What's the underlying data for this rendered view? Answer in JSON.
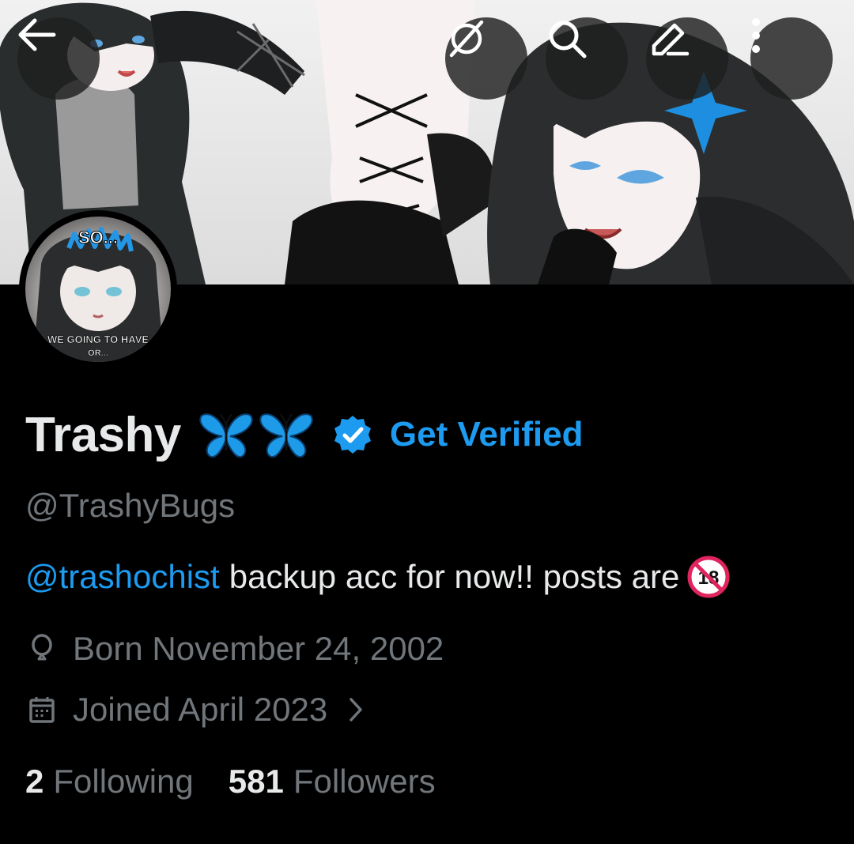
{
  "profile": {
    "display_name": "Trashy",
    "name_emoji": [
      "butterfly",
      "butterfly"
    ],
    "get_verified_label": "Get Verified",
    "handle": "@TrashyBugs",
    "bio": {
      "mention": "@trashochist",
      "text": "backup acc for now!! posts are",
      "emoji": "no-one-under-eighteen"
    },
    "born": "Born November 24, 2002",
    "joined": "Joined April 2023"
  },
  "stats": {
    "following_count": "2",
    "following_label": "Following",
    "followers_count": "581",
    "followers_label": "Followers"
  },
  "avatar": {
    "meme_top_text": "SO...",
    "meme_bottom_text": "WE GOING TO HAVE",
    "meme_bottom_text_2": "OR..."
  },
  "toolbar": {
    "icons": [
      "back-arrow-icon",
      "grok-icon",
      "search-icon",
      "edit-icon",
      "more-vertical-icon"
    ]
  },
  "colors": {
    "background": "#000000",
    "primary_text": "#e7e9ea",
    "secondary_text": "#71767b",
    "accent_blue": "#1d9bf0",
    "butterfly_blue": "#1e9be8"
  }
}
